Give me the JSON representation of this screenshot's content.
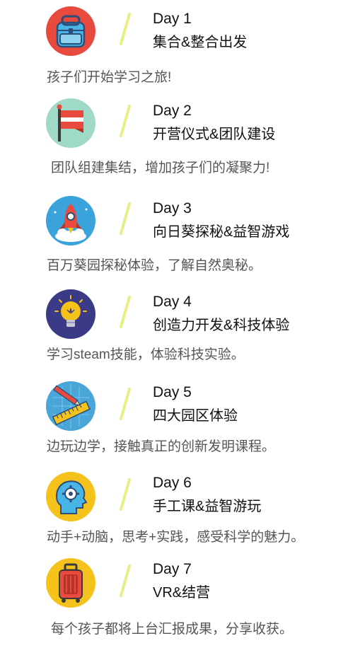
{
  "days": [
    {
      "day": "Day 1",
      "title": "集合&整合出发",
      "desc": "孩子们开始学习之旅!",
      "icon": "backpack-icon",
      "bg": "#e84a3d"
    },
    {
      "day": "Day 2",
      "title": "开营仪式&团队建设",
      "desc": "团队组建集结，增加孩子们的凝聚力!",
      "icon": "flag-icon",
      "bg": "#9fd9c8"
    },
    {
      "day": "Day 3",
      "title": "向日葵探秘&益智游戏",
      "desc": "百万葵园探秘体验，了解自然奥秘。",
      "icon": "rocket-icon",
      "bg": "#3aa3dc"
    },
    {
      "day": "Day 4",
      "title": "创造力开发&科技体验",
      "desc": "学习steam技能，体验科技实验。",
      "icon": "lightbulb-icon",
      "bg": "#3b3a86"
    },
    {
      "day": "Day 5",
      "title": "四大园区体验",
      "desc": "边玩边学，接触真正的创新发明课程。",
      "icon": "ruler-pencil-icon",
      "bg": "#4aa6d8"
    },
    {
      "day": "Day 6",
      "title": "手工课&益智游玩",
      "desc": "动手+动脑，思考+实践，感受科学的魅力。",
      "icon": "brain-gear-icon",
      "bg": "#f5c21b"
    },
    {
      "day": "Day 7",
      "title": "VR&结营",
      "desc": "每个孩子都将上台汇报成果，分享收获。",
      "icon": "luggage-icon",
      "bg": "#f5c21b"
    }
  ],
  "accent": "#e6ee84"
}
